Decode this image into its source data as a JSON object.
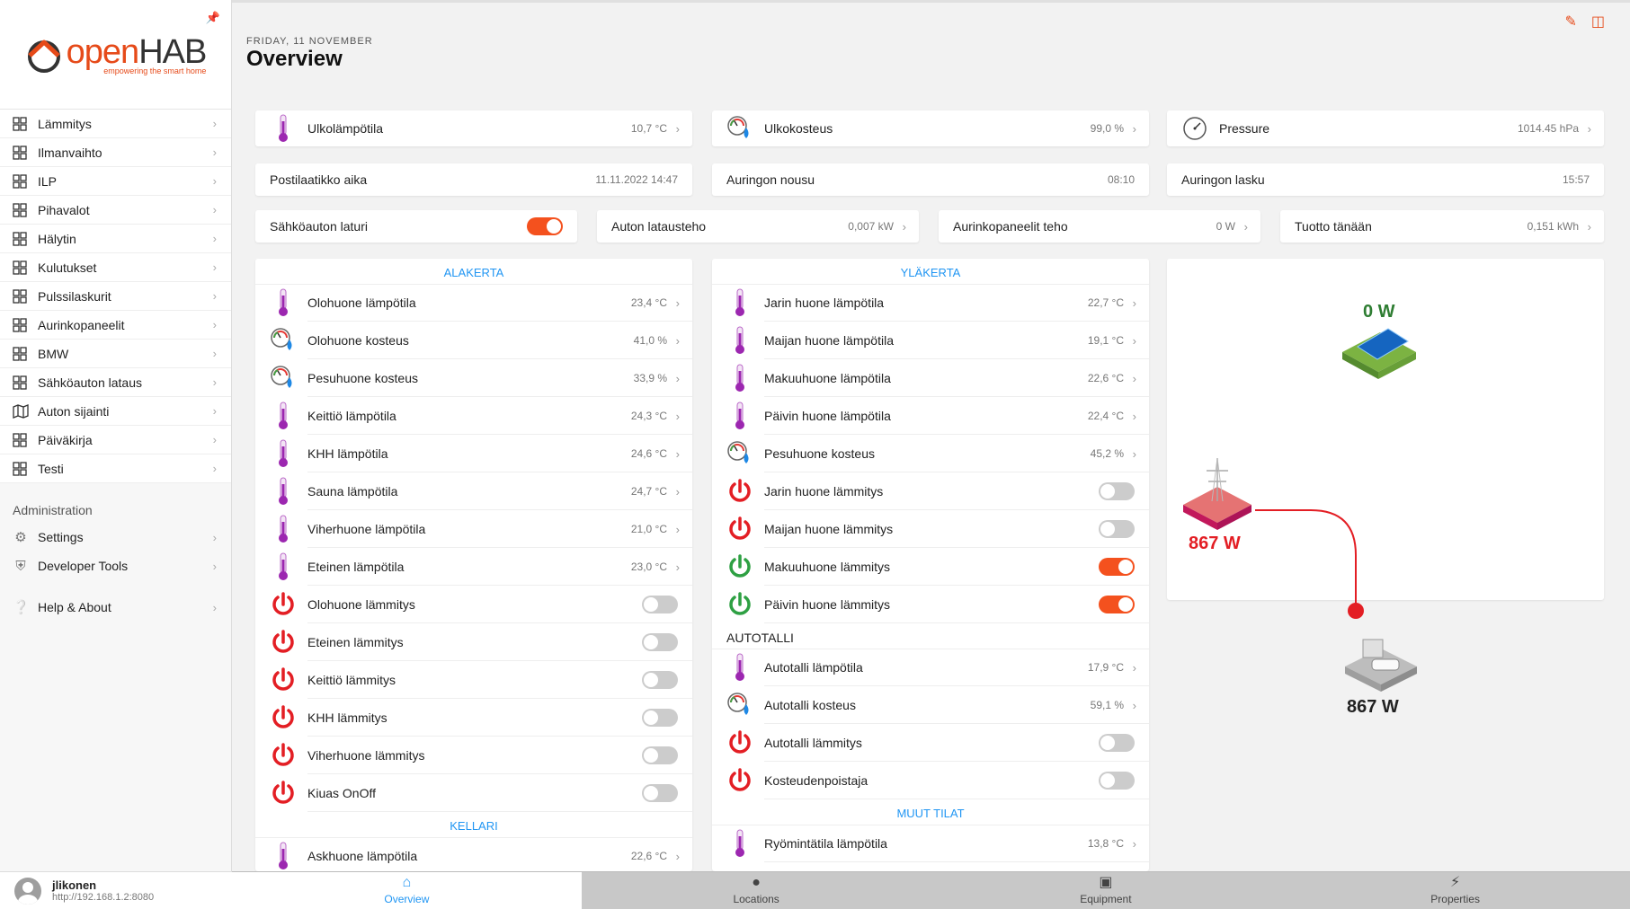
{
  "sidebar": {
    "logo_name_a": "open",
    "logo_name_b": "HAB",
    "logo_tag": "empowering the smart home",
    "items": [
      {
        "label": "Lämmitys"
      },
      {
        "label": "Ilmanvaihto"
      },
      {
        "label": "ILP"
      },
      {
        "label": "Pihavalot"
      },
      {
        "label": "Hälytin"
      },
      {
        "label": "Kulutukset"
      },
      {
        "label": "Pulssilaskurit"
      },
      {
        "label": "Aurinkopaneelit"
      },
      {
        "label": "BMW"
      },
      {
        "label": "Sähköauton lataus"
      },
      {
        "label": "Auton sijainti"
      },
      {
        "label": "Päiväkirja"
      },
      {
        "label": "Testi"
      }
    ],
    "admin_title": "Administration",
    "admin_items": [
      {
        "label": "Settings"
      },
      {
        "label": "Developer Tools"
      }
    ],
    "help_label": "Help & About",
    "user_name": "jlikonen",
    "user_url": "http://192.168.1.2:8080"
  },
  "header": {
    "date": "FRIDAY, 11 NOVEMBER",
    "title": "Overview"
  },
  "top_cards": {
    "ulkolampotila": {
      "label": "Ulkolämpötila",
      "value": "10,7 °C"
    },
    "ulkokosteus": {
      "label": "Ulkokosteus",
      "value": "99,0 %"
    },
    "pressure": {
      "label": "Pressure",
      "value": "1014.45 hPa"
    },
    "postilaatikko": {
      "label": "Postilaatikko aika",
      "value": "11.11.2022 14:47"
    },
    "auringon_nousu": {
      "label": "Auringon nousu",
      "value": "08:10"
    },
    "auringon_lasku": {
      "label": "Auringon lasku",
      "value": "15:57"
    },
    "laturi": {
      "label": "Sähköauton laturi",
      "on": true
    },
    "latausteho": {
      "label": "Auton latausteho",
      "value": "0,007 kW"
    },
    "aurinkoteho": {
      "label": "Aurinkopaneelit teho",
      "value": "0 W"
    },
    "tuotto": {
      "label": "Tuotto tänään",
      "value": "0,151 kWh"
    }
  },
  "alakerta": {
    "title": "ALAKERTA",
    "rows": [
      {
        "type": "temp",
        "label": "Olohuone lämpötila",
        "value": "23,4 °C"
      },
      {
        "type": "hum",
        "label": "Olohuone kosteus",
        "value": "41,0 %"
      },
      {
        "type": "hum",
        "label": "Pesuhuone kosteus",
        "value": "33,9 %"
      },
      {
        "type": "temp",
        "label": "Keittiö lämpötila",
        "value": "24,3 °C"
      },
      {
        "type": "temp",
        "label": "KHH lämpötila",
        "value": "24,6 °C"
      },
      {
        "type": "temp",
        "label": "Sauna lämpötila",
        "value": "24,7 °C"
      },
      {
        "type": "temp",
        "label": "Viherhuone lämpötila",
        "value": "21,0 °C"
      },
      {
        "type": "temp",
        "label": "Eteinen lämpötila",
        "value": "23,0 °C"
      },
      {
        "type": "switch",
        "label": "Olohuone lämmitys",
        "on": false
      },
      {
        "type": "switch",
        "label": "Eteinen lämmitys",
        "on": false
      },
      {
        "type": "switch",
        "label": "Keittiö lämmitys",
        "on": false
      },
      {
        "type": "switch",
        "label": "KHH lämmitys",
        "on": false
      },
      {
        "type": "switch",
        "label": "Viherhuone lämmitys",
        "on": false
      },
      {
        "type": "switch",
        "label": "Kiuas OnOff",
        "on": false
      }
    ],
    "kellari_title": "KELLARI",
    "kellari_rows": [
      {
        "type": "temp",
        "label": "Askhuone lämpötila",
        "value": "22,6 °C"
      }
    ]
  },
  "ylakerta": {
    "title": "YLÄKERTA",
    "rows": [
      {
        "type": "temp",
        "label": "Jarin huone lämpötila",
        "value": "22,7 °C"
      },
      {
        "type": "temp",
        "label": "Maijan huone lämpötila",
        "value": "19,1 °C"
      },
      {
        "type": "temp",
        "label": "Makuuhuone lämpötila",
        "value": "22,6 °C"
      },
      {
        "type": "temp",
        "label": "Päivin huone lämpötila",
        "value": "22,4 °C"
      },
      {
        "type": "hum",
        "label": "Pesuhuone kosteus",
        "value": "45,2 %"
      },
      {
        "type": "switch",
        "label": "Jarin huone lämmitys",
        "on": false
      },
      {
        "type": "switch",
        "label": "Maijan huone lämmitys",
        "on": false
      },
      {
        "type": "switch",
        "label": "Makuuhuone lämmitys",
        "on": true
      },
      {
        "type": "switch",
        "label": "Päivin huone lämmitys",
        "on": true
      }
    ],
    "autotalli_title": "AUTOTALLI",
    "autotalli_rows": [
      {
        "type": "temp",
        "label": "Autotalli lämpötila",
        "value": "17,9 °C"
      },
      {
        "type": "hum",
        "label": "Autotalli kosteus",
        "value": "59,1 %"
      },
      {
        "type": "switch",
        "label": "Autotalli lämmitys",
        "on": false
      },
      {
        "type": "switch",
        "label": "Kosteudenpoistaja",
        "on": false
      }
    ],
    "muut_title": "MUUT TILAT",
    "muut_rows": [
      {
        "type": "temp",
        "label": "Ryömintätila lämpötila",
        "value": "13,8 °C"
      }
    ]
  },
  "energy": {
    "solar": "0 W",
    "grid": "867 W",
    "home": "867 W"
  },
  "tabs": [
    {
      "label": "Overview",
      "active": true,
      "icon": "home-icon"
    },
    {
      "label": "Locations",
      "active": false,
      "icon": "map-pin-icon"
    },
    {
      "label": "Equipment",
      "active": false,
      "icon": "cube-icon"
    },
    {
      "label": "Properties",
      "active": false,
      "icon": "bolt-icon"
    }
  ],
  "colors": {
    "accent": "#f4511e",
    "blue": "#2196f3",
    "red": "#e31e24",
    "green": "#2ea043"
  }
}
